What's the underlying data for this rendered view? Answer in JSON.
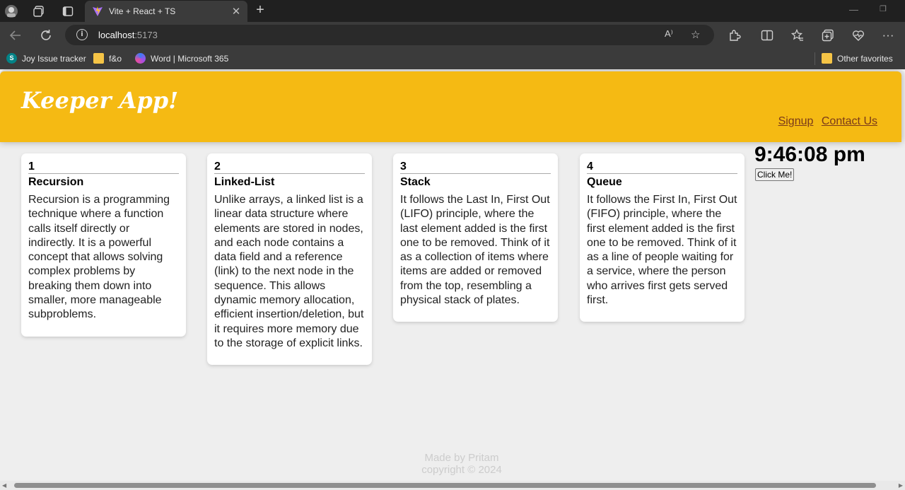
{
  "browser": {
    "tab": {
      "title": "Vite + React + TS",
      "close": "✕"
    },
    "address": {
      "host": "localhost",
      "port": ":5173"
    },
    "read_aloud": "A⁾",
    "favorites": [
      {
        "label": "Joy Issue tracker"
      },
      {
        "label": "f&o"
      },
      {
        "label": "Word | Microsoft 365"
      }
    ],
    "other_favorites": "Other favorites"
  },
  "app": {
    "title": "Keeper App!",
    "nav": {
      "signup": "Signup",
      "contact": "Contact Us"
    },
    "notes": [
      {
        "id": "1",
        "title": "Recursion",
        "content": "Recursion is a programming technique where a function calls itself directly or indirectly. It is a powerful concept that allows solving complex problems by breaking them down into smaller, more manageable subproblems."
      },
      {
        "id": "2",
        "title": "Linked-List",
        "content": "Unlike arrays, a linked list is a linear data structure where elements are stored in nodes, and each node contains a data field and a reference (link) to the next node in the sequence. This allows dynamic memory allocation, efficient insertion/deletion, but it requires more memory due to the storage of explicit links."
      },
      {
        "id": "3",
        "title": "Stack",
        "content": "It follows the Last In, First Out (LIFO) principle, where the last element added is the first one to be removed. Think of it as a collection of items where items are added or removed from the top, resembling a physical stack of plates."
      },
      {
        "id": "4",
        "title": "Queue",
        "content": "It follows the First In, First Out (FIFO) principle, where the first element added is the first one to be removed. Think of it as a line of people waiting for a service, where the person who arrives first gets served first."
      }
    ],
    "clock": "9:46:08 pm",
    "button_label": "Click Me!",
    "footer": {
      "line1": "Made by Pritam",
      "line2": "copyright © 2024"
    }
  },
  "colors": {
    "header": "#f5ba13",
    "background": "#eeeeee",
    "card": "#ffffff"
  }
}
